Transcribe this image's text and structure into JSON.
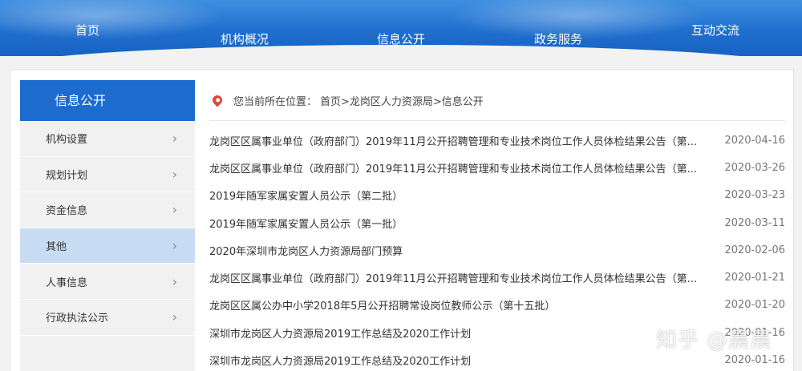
{
  "nav": {
    "items": [
      {
        "label": "首页"
      },
      {
        "label": "机构概况"
      },
      {
        "label": "信息公开"
      },
      {
        "label": "政务服务"
      },
      {
        "label": "互动交流"
      }
    ]
  },
  "sidebar": {
    "title": "信息公开",
    "items": [
      {
        "label": "机构设置"
      },
      {
        "label": "规划计划"
      },
      {
        "label": "资金信息"
      },
      {
        "label": "其他",
        "active": true
      },
      {
        "label": "人事信息"
      },
      {
        "label": "行政执法公示"
      }
    ]
  },
  "breadcrumb": {
    "label": "您当前所在位置：",
    "path": "首页>龙岗区人力资源局>信息公开"
  },
  "list": [
    {
      "title": "龙岗区区属事业单位（政府部门）2019年11月公开招聘管理和专业技术岗位工作人员体检结果公告（第...",
      "date": "2020-04-16"
    },
    {
      "title": "龙岗区区属事业单位（政府部门）2019年11月公开招聘管理和专业技术岗位工作人员体检结果公告（第...",
      "date": "2020-03-26"
    },
    {
      "title": "2019年随军家属安置人员公示（第二批）",
      "date": "2020-03-23"
    },
    {
      "title": "2019年随军家属安置人员公示（第一批）",
      "date": "2020-03-11"
    },
    {
      "title": "2020年深圳市龙岗区人力资源局部门预算",
      "date": "2020-02-06"
    },
    {
      "title": "龙岗区区属事业单位（政府部门）2019年11月公开招聘管理和专业技术岗位工作人员体检结果公告（第...",
      "date": "2020-01-21"
    },
    {
      "title": "龙岗区区属公办中小学2018年5月公开招聘常设岗位教师公示（第十五批）",
      "date": "2020-01-20"
    },
    {
      "title": "深圳市龙岗区人力资源局2019工作总结及2020工作计划",
      "date": "2020-01-16"
    },
    {
      "title": "深圳市龙岗区人力资源局2019工作总结及2020工作计划",
      "date": "2020-01-16"
    }
  ],
  "watermark": "知乎 @晨晨",
  "colors": {
    "primary": "#1c6cd0",
    "active_bg": "#c7dcf2",
    "pin": "#e0463a"
  }
}
